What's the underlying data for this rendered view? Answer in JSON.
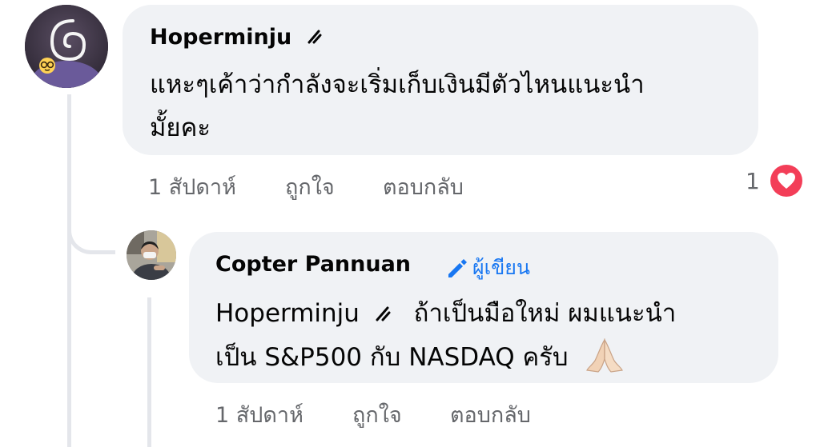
{
  "comments": [
    {
      "author": "Hoperminju",
      "text_lines": [
        "แหะๆเค้าว่ากำลังจะเริ่มเก็บเงินมีตัวไหนแนะนำ",
        "มั้ยคะ"
      ],
      "timestamp": "1 สัปดาห์",
      "like_label": "ถูกใจ",
      "reply_label": "ตอบกลับ",
      "reaction_count": "1",
      "reaction_icon": "heart-icon",
      "avatar": "spiral-avatar"
    },
    {
      "author": "Copter Pannuan",
      "author_badge": "ผู้เขียน",
      "badge_icon": "pencil-icon",
      "mention": "Hoperminju",
      "text_line1_rest": "ถ้าเป็นมือใหม่ ผมแนะนำ",
      "text_line2": "เป็น S&P500 กับ NASDAQ ครับ",
      "emoji": "🙏🏻",
      "timestamp": "1 สัปดาห์",
      "like_label": "ถูกใจ",
      "reply_label": "ตอบกลับ",
      "avatar": "photo-avatar"
    }
  ],
  "colors": {
    "bubble": "#f0f2f5",
    "secondary_text": "#65676b",
    "badge_blue": "#1877f2",
    "heart": "#f33e58",
    "thread_line": "#e4e6eb"
  }
}
